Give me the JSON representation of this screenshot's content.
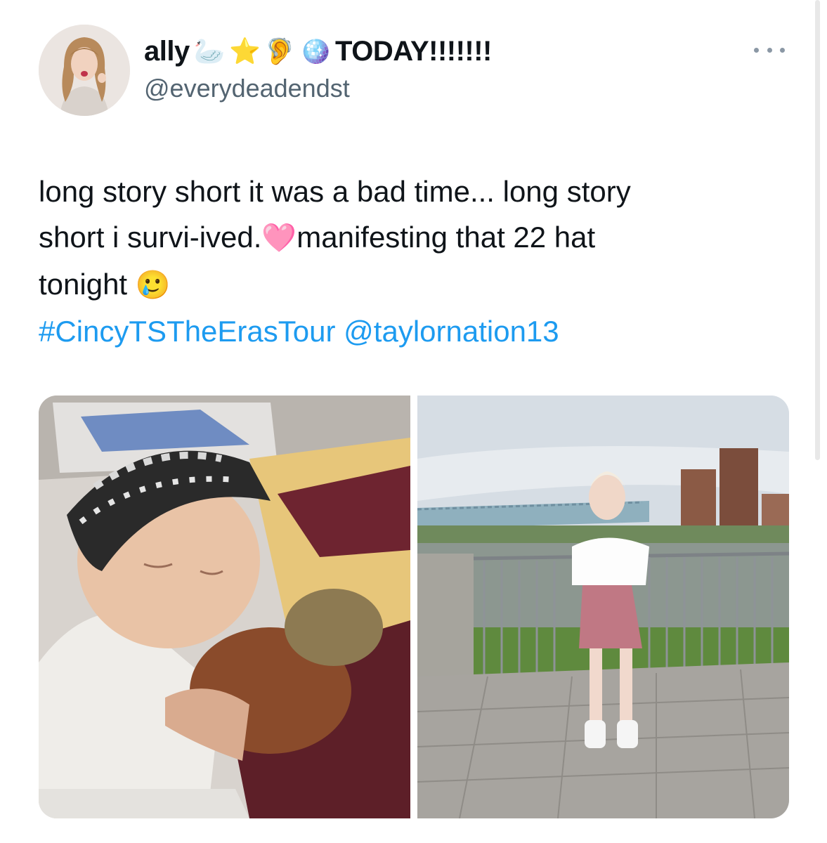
{
  "tweet": {
    "display_name": "ally",
    "name_emojis": [
      "🦢",
      "⭐",
      "🦻",
      "🪩"
    ],
    "name_suffix": "TODAY!!!!!!!",
    "handle": "@everydeadendst",
    "text_lines": [
      "long story short it was a bad time... long story",
      "short i survi-ived.",
      "manifesting that 22 hat",
      "tonight"
    ],
    "text_emojis": [
      "🩷",
      "🥲"
    ],
    "hashtag": "#CincyTSTheErasTour",
    "mention": "@taylornation13"
  },
  "media": {
    "photo_1": "hospital-bed-photo",
    "photo_2": "riverside-railing-photo"
  },
  "colors": {
    "link": "#1d9bf0",
    "text": "#0f1419",
    "secondary": "#536471"
  }
}
